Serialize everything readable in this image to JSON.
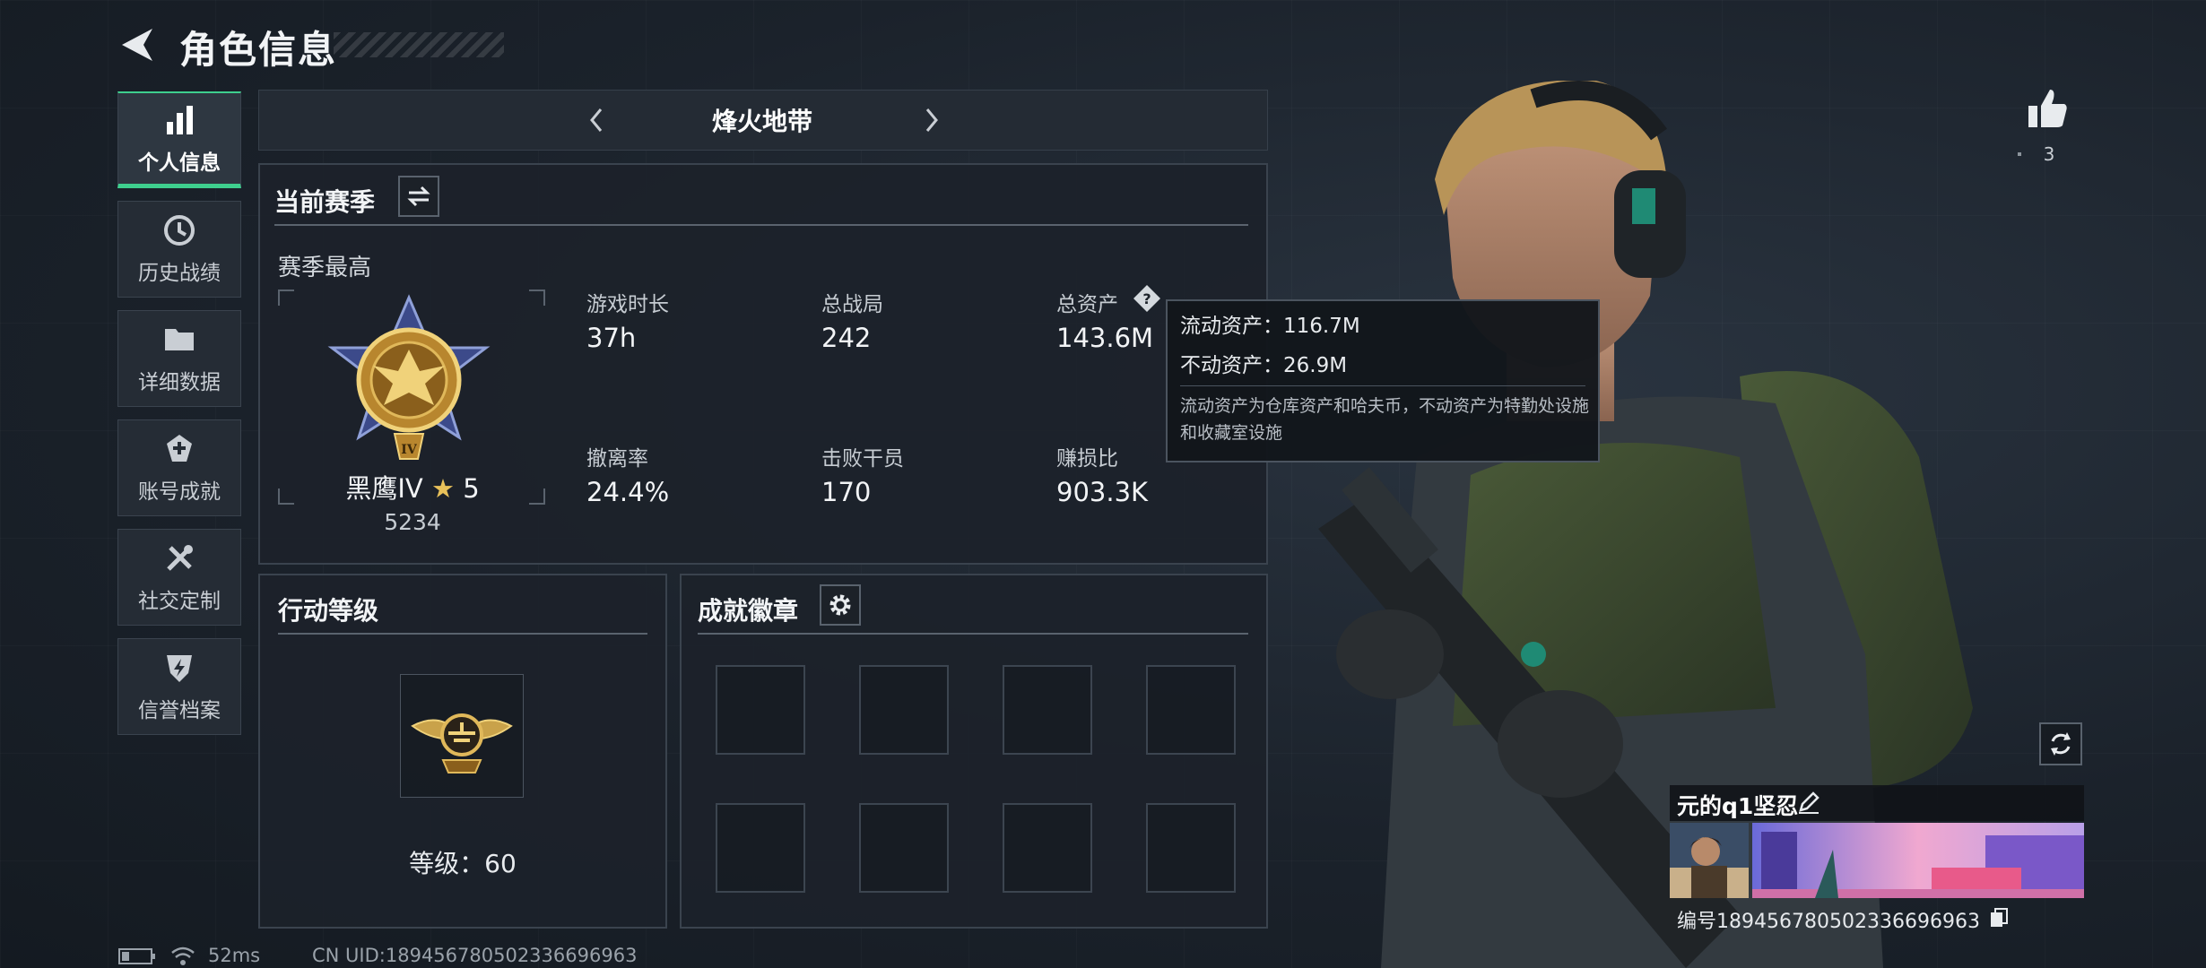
{
  "header": {
    "title": "角色信息"
  },
  "nav": {
    "items": [
      {
        "label": "个人信息",
        "icon": "bar-chart-icon",
        "active": true
      },
      {
        "label": "历史战绩",
        "icon": "history-clock-icon",
        "active": false
      },
      {
        "label": "详细数据",
        "icon": "folder-icon",
        "active": false
      },
      {
        "label": "账号成就",
        "icon": "achievement-badge-icon",
        "active": false
      },
      {
        "label": "社交定制",
        "icon": "wrench-screwdriver-icon",
        "active": false
      },
      {
        "label": "信誉档案",
        "icon": "shield-bolt-icon",
        "active": false
      }
    ]
  },
  "mode_selector": {
    "title": "烽火地带"
  },
  "season": {
    "section_title": "当前赛季",
    "subtitle": "赛季最高",
    "rank_name": "黑鹰IV",
    "rank_stars": "5",
    "rank_points": "5234",
    "stats": [
      {
        "label": "游戏时长",
        "value": "37h"
      },
      {
        "label": "总战局",
        "value": "242"
      },
      {
        "label": "总资产",
        "value": "143.6M"
      },
      {
        "label": "撤离率",
        "value": "24.4%"
      },
      {
        "label": "击败干员",
        "value": "170"
      },
      {
        "label": "赚损比",
        "value": "903.3K"
      }
    ]
  },
  "tooltip": {
    "liquid": "流动资产：116.7M",
    "fixed": "不动资产：26.9M",
    "note": "流动资产为仓库资产和哈夫币，不动资产为特勤处设施和收藏室设施"
  },
  "action_level": {
    "title": "行动等级",
    "level_text": "等级：60"
  },
  "badges": {
    "title": "成就徽章",
    "slots": 8
  },
  "likes": {
    "count": "3"
  },
  "player_card": {
    "name": "元的q1坚忍",
    "id_text": "编号1894567805023366969​63"
  },
  "status": {
    "ping": "52ms",
    "uid": "CN UID:1894567805023366969​63"
  },
  "colors": {
    "accent": "#3ecf8e",
    "gold": "#c9a24a",
    "panel": "#1c222a"
  }
}
